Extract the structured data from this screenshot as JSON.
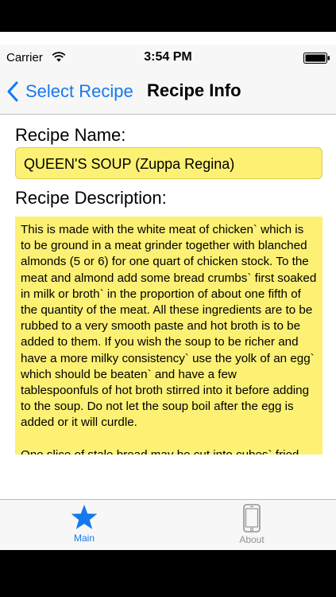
{
  "status_bar": {
    "carrier": "Carrier",
    "time": "3:54 PM",
    "wifi_icon": "wifi-icon",
    "battery_icon": "battery-icon"
  },
  "nav": {
    "back_label": "Select Recipe",
    "title": "Recipe Info"
  },
  "recipe": {
    "name_label": "Recipe Name:",
    "name_value": "QUEEN'S SOUP (Zuppa Regina)",
    "description_label": "Recipe Description:",
    "description": "This is made with the white meat of chicken` which is to be ground in a meat grinder together with blanched almonds (5 or 6) for one quart of chicken stock. To the meat and almond add some bread crumbs` first soaked in milk or broth` in the proportion of about one fifth of the quantity of the meat. All these ingredients are to be rubbed to a very smooth paste and hot broth is to be added to them. If you wish the soup to be richer and have a more milky consistency` use the yolk of an egg` which should be beaten` and have a few tablespoonfuls of hot broth stirred into it before adding to the soup. Do not let the soup boil after the egg is added or it will curdle.\n\nOne slice of stale bread may be cut into cubes` fried"
  },
  "tabs": [
    {
      "label": "Main",
      "icon": "star-icon",
      "selected": true
    },
    {
      "label": "About",
      "icon": "phone-icon",
      "selected": false
    }
  ],
  "colors": {
    "accent": "#1479ef",
    "field_yellow": "#fcf174",
    "bar_bg": "#f7f7f7",
    "inactive_tab": "#929292"
  }
}
